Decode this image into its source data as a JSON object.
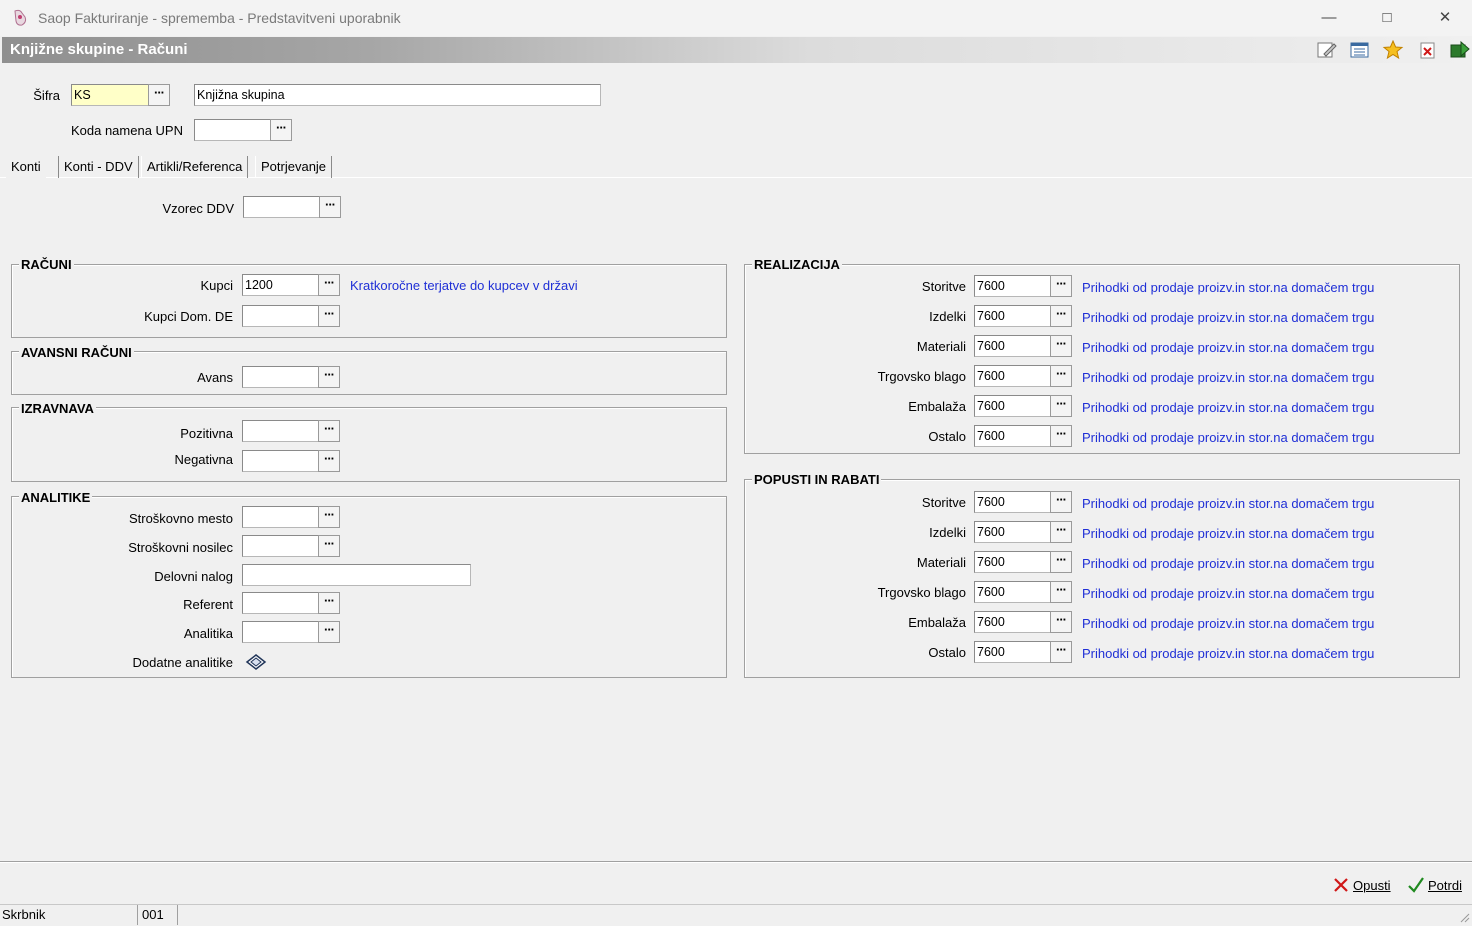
{
  "window": {
    "title": "Saop Fakturiranje - sprememba - Predstavitveni uporabnik"
  },
  "form": {
    "title": "Knjižne skupine - Računi"
  },
  "header": {
    "sifra_label": "Šifra",
    "sifra_value": "KS",
    "naziv_value": "Knjižna skupina",
    "upn_label": "Koda namena UPN",
    "upn_value": ""
  },
  "tabs": [
    "Konti",
    "Konti - DDV",
    "Artikli/Referenca",
    "Potrjevanje"
  ],
  "vzorec": {
    "label": "Vzorec DDV",
    "value": ""
  },
  "racuni": {
    "title": "RAČUNI",
    "kupci_label": "Kupci",
    "kupci_value": "1200",
    "kupci_desc": "Kratkoročne terjatve do kupcev v državi",
    "kupci_dom_label": "Kupci Dom. DE",
    "kupci_dom_value": ""
  },
  "avansni": {
    "title": "AVANSNI RAČUNI",
    "avans_label": "Avans",
    "avans_value": ""
  },
  "izravnava": {
    "title": "IZRAVNAVA",
    "pozitivna_label": "Pozitivna",
    "negativna_label": "Negativna"
  },
  "analitike": {
    "title": "ANALITIKE",
    "strosk_mesto": "Stroškovno mesto",
    "strosk_nosilec": "Stroškovni nosilec",
    "delovni_nalog": "Delovni nalog",
    "referent": "Referent",
    "analitika": "Analitika",
    "dodatne": "Dodatne analitike"
  },
  "realizacija": {
    "title": "REALIZACIJA",
    "rows": [
      {
        "label": "Storitve",
        "value": "7600",
        "desc": "Prihodki od prodaje proizv.in stor.na domačem trgu"
      },
      {
        "label": "Izdelki",
        "value": "7600",
        "desc": "Prihodki od prodaje proizv.in stor.na domačem trgu"
      },
      {
        "label": "Materiali",
        "value": "7600",
        "desc": "Prihodki od prodaje proizv.in stor.na domačem trgu"
      },
      {
        "label": "Trgovsko blago",
        "value": "7600",
        "desc": "Prihodki od prodaje proizv.in stor.na domačem trgu"
      },
      {
        "label": "Embalaža",
        "value": "7600",
        "desc": "Prihodki od prodaje proizv.in stor.na domačem trgu"
      },
      {
        "label": "Ostalo",
        "value": "7600",
        "desc": "Prihodki od prodaje proizv.in stor.na domačem trgu"
      }
    ]
  },
  "popusti": {
    "title": "POPUSTI IN RABATI",
    "rows": [
      {
        "label": "Storitve",
        "value": "7600",
        "desc": "Prihodki od prodaje proizv.in stor.na domačem trgu"
      },
      {
        "label": "Izdelki",
        "value": "7600",
        "desc": "Prihodki od prodaje proizv.in stor.na domačem trgu"
      },
      {
        "label": "Materiali",
        "value": "7600",
        "desc": "Prihodki od prodaje proizv.in stor.na domačem trgu"
      },
      {
        "label": "Trgovsko blago",
        "value": "7600",
        "desc": "Prihodki od prodaje proizv.in stor.na domačem trgu"
      },
      {
        "label": "Embalaža",
        "value": "7600",
        "desc": "Prihodki od prodaje proizv.in stor.na domačem trgu"
      },
      {
        "label": "Ostalo",
        "value": "7600",
        "desc": "Prihodki od prodaje proizv.in stor.na domačem trgu"
      }
    ]
  },
  "buttons": {
    "opusti": "Opusti",
    "potrdi": "Potrdi",
    "ellipsis": "···"
  },
  "statusbar": {
    "user": "Skrbnik",
    "code": "001"
  },
  "colors": {
    "link": "#1f2fd6",
    "highlight_input": "#ffffc8"
  },
  "icons": [
    "app-logo-icon",
    "minimize-icon",
    "maximize-icon",
    "close-icon",
    "edit-icon",
    "list-icon",
    "favorite-star-icon",
    "delete-icon",
    "export-icon",
    "additional-analytics-icon",
    "cancel-x-icon",
    "confirm-check-icon",
    "resize-grip-icon"
  ]
}
